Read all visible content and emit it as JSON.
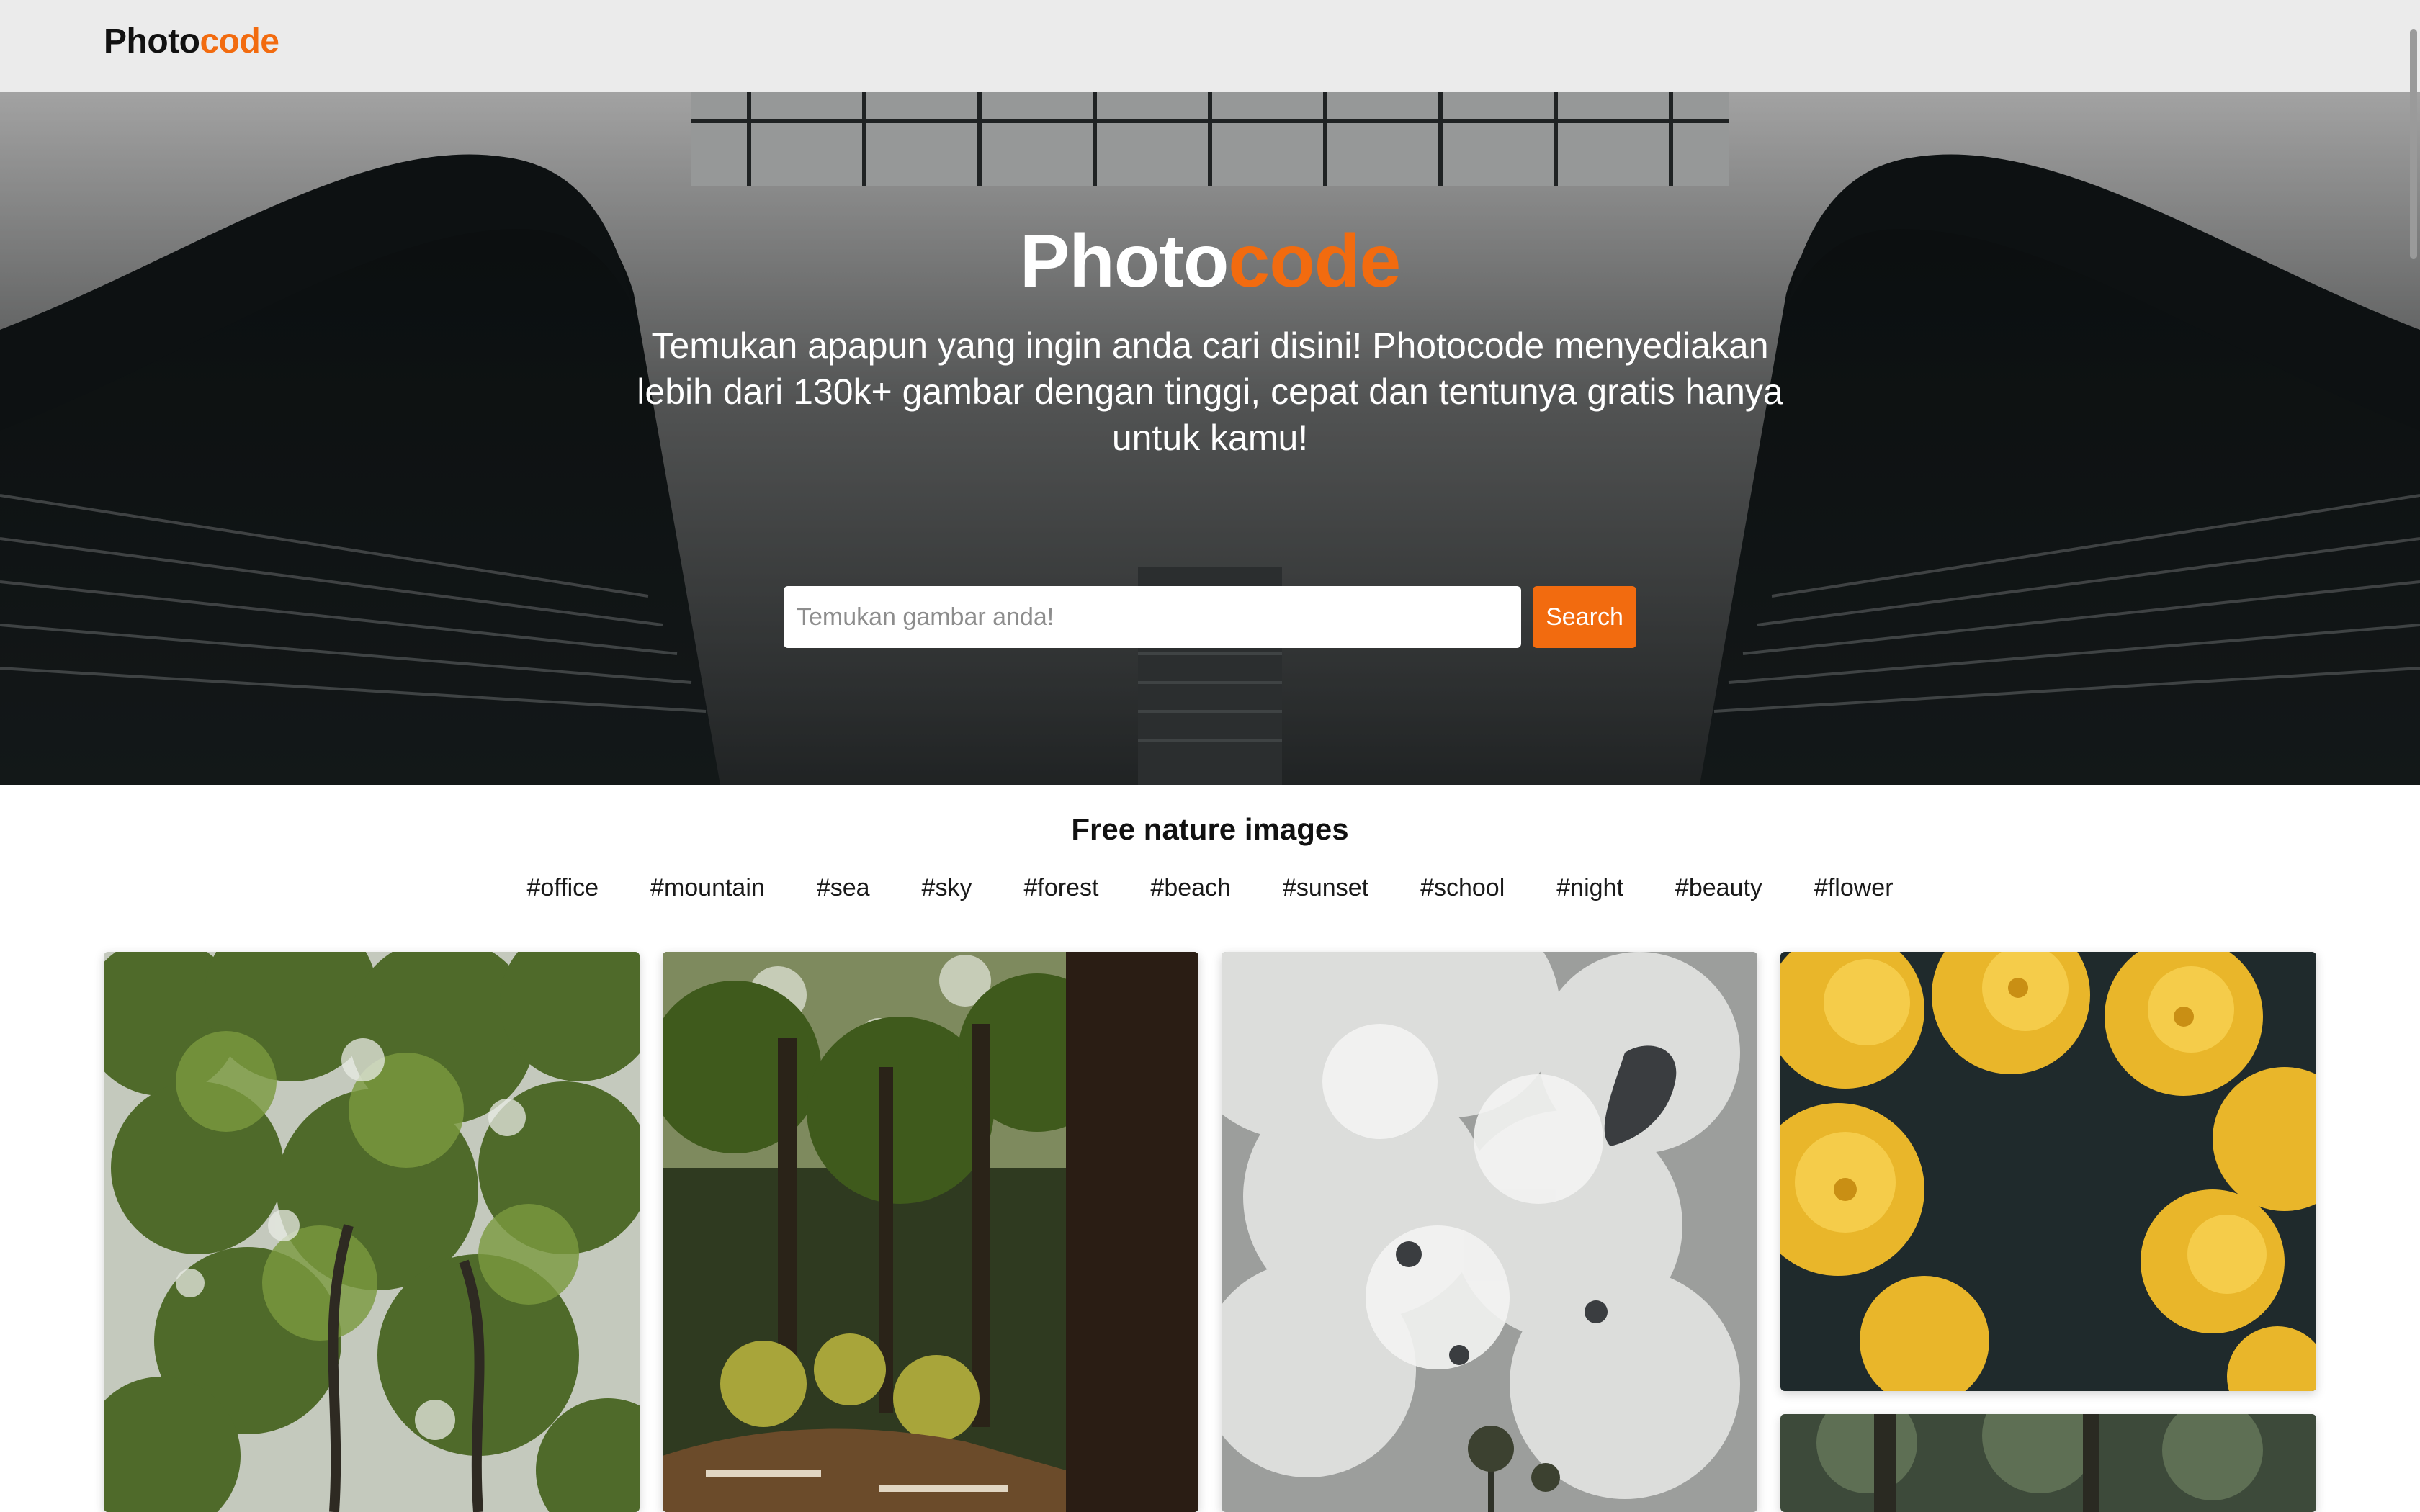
{
  "navbar": {
    "brand_part1": "Photo",
    "brand_part2": "code"
  },
  "hero": {
    "title_part1": "Photo",
    "title_part2": "code",
    "subtitle": "Temukan apapun yang ingin anda cari disini! Photocode menyediakan lebih dari 130k+ gambar dengan tinggi, cepat dan tentunya gratis hanya untuk kamu!",
    "search_placeholder": "Temukan gambar anda!",
    "search_value": "",
    "search_button_label": "Search"
  },
  "section": {
    "title": "Free nature images",
    "tags": [
      "#office",
      "#mountain",
      "#sea",
      "#sky",
      "#forest",
      "#beach",
      "#sunset",
      "#school",
      "#night",
      "#beauty",
      "#flower"
    ]
  },
  "gallery": {
    "items": [
      {
        "icon": "forest-canopy-image"
      },
      {
        "icon": "forest-path-image"
      },
      {
        "icon": "cloudy-sky-image"
      },
      {
        "icon": "yellow-flowers-image"
      },
      {
        "icon": "dark-forest-image"
      }
    ]
  },
  "colors": {
    "accent": "#f26b0f",
    "navbar_bg": "#ebebeb",
    "hero_dark": "#1e2324"
  }
}
